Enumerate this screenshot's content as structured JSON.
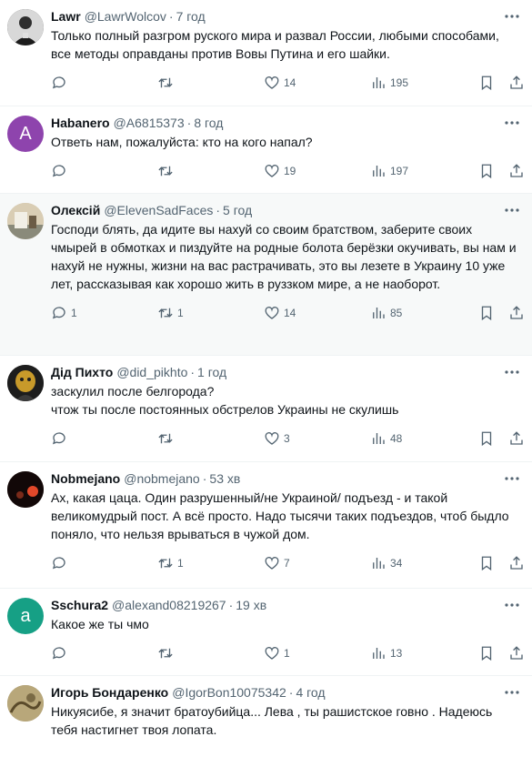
{
  "tweets": [
    {
      "name": "Lawr",
      "handle": "@LawrWolcov",
      "time": "7 год",
      "text": "Только полный разгром руского мира и развал России, любыми способами, все методы оправданы против Вовы Путина и его шайки.",
      "replies": "",
      "retweets": "",
      "likes": "14",
      "views": "195",
      "avatar_color": "#3a3a3a",
      "avatar_letter": ""
    },
    {
      "name": "Habanero",
      "handle": "@A6815373",
      "time": "8 год",
      "text": "Ответь нам, пожалуйста: кто на кого напал?",
      "replies": "",
      "retweets": "",
      "likes": "19",
      "views": "197",
      "avatar_color": "#8e44ad",
      "avatar_letter": "A"
    },
    {
      "name": "Олексій",
      "handle": "@ElevenSadFaces",
      "time": "5 год",
      "text": "Господи блять, да идите вы нахуй со своим братством, заберите своих чмырей в обмотках и пиздуйте на родные болота берёзки окучивать, вы нам и нахуй не нужны, жизни на вас растрачивать, это вы лезете в Украину 10 уже лет, рассказывая как хорошо жить в руззком мире, а не наоборот.",
      "replies": "1",
      "retweets": "1",
      "likes": "14",
      "views": "85",
      "avatar_color": "#c9b99a",
      "avatar_letter": ""
    },
    {
      "name": "Дід Пихто",
      "handle": "@did_pikhto",
      "time": "1 год",
      "text": "заскулил после белгорода?\nчтож ты после постоянных обстрелов Украины не скулишь",
      "replies": "",
      "retweets": "",
      "likes": "3",
      "views": "48",
      "avatar_color": "#2b2b2b",
      "avatar_letter": ""
    },
    {
      "name": "Nobmejano",
      "handle": "@nobmejano",
      "time": "53 хв",
      "text": "Ах, какая цаца. Один разрушенный/не Украиной/ подъезд - и такой великомудрый пост. А всё просто. Надо тысячи таких подъездов, чтоб быдло поняло, что нельзя врываться в чужой дом.",
      "replies": "",
      "retweets": "1",
      "likes": "7",
      "views": "34",
      "avatar_color": "#3b1a12",
      "avatar_letter": ""
    },
    {
      "name": "Sschura2",
      "handle": "@alexand08219267",
      "time": "19 хв",
      "text": "Какое же ты чмо",
      "replies": "",
      "retweets": "",
      "likes": "1",
      "views": "13",
      "avatar_color": "#16a085",
      "avatar_letter": "a"
    },
    {
      "name": "Игорь Бондаренко",
      "handle": "@IgorBon10075342",
      "time": "4 год",
      "text": "Никуясибе, я значит братоубийца... Лева , ты рашистское говно . Надеюсь тебя настигнет твоя лопата.",
      "replies": "",
      "retweets": "",
      "likes": "",
      "views": "",
      "avatar_color": "#8a7a55",
      "avatar_letter": ""
    }
  ]
}
